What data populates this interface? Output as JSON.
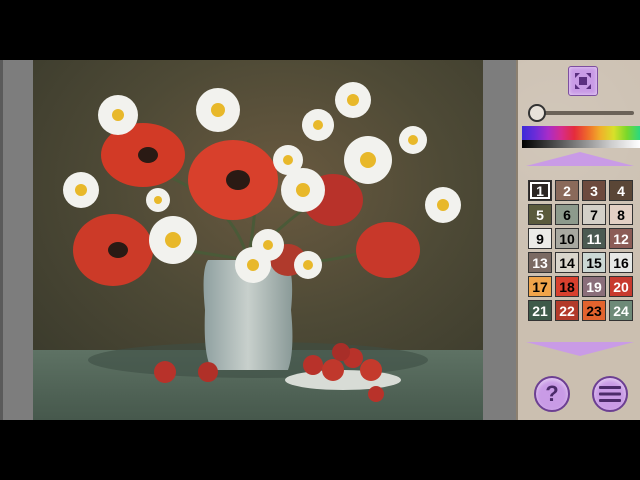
{
  "palette": {
    "selected_index": 0,
    "swatches": [
      {
        "number": "1",
        "color": "#2c2623",
        "text_color": "#ffffff"
      },
      {
        "number": "2",
        "color": "#8a6a5a",
        "text_color": "#ffffff"
      },
      {
        "number": "3",
        "color": "#6d4a3e",
        "text_color": "#ffffff"
      },
      {
        "number": "4",
        "color": "#5a4636",
        "text_color": "#ffffff"
      },
      {
        "number": "5",
        "color": "#5a5a3c",
        "text_color": "#ffffff"
      },
      {
        "number": "6",
        "color": "#8d9a8c",
        "text_color": "#000000"
      },
      {
        "number": "7",
        "color": "#d3d0c8",
        "text_color": "#000000"
      },
      {
        "number": "8",
        "color": "#e3d0c4",
        "text_color": "#000000"
      },
      {
        "number": "9",
        "color": "#ecebe7",
        "text_color": "#000000"
      },
      {
        "number": "10",
        "color": "#a8a8a0",
        "text_color": "#000000"
      },
      {
        "number": "11",
        "color": "#4a5a52",
        "text_color": "#ffffff"
      },
      {
        "number": "12",
        "color": "#8c5c56",
        "text_color": "#ffffff"
      },
      {
        "number": "13",
        "color": "#7a6a62",
        "text_color": "#ffffff"
      },
      {
        "number": "14",
        "color": "#dad6cc",
        "text_color": "#000000"
      },
      {
        "number": "15",
        "color": "#cbd8d4",
        "text_color": "#000000"
      },
      {
        "number": "16",
        "color": "#e6e8e6",
        "text_color": "#000000"
      },
      {
        "number": "17",
        "color": "#f0a44a",
        "text_color": "#000000"
      },
      {
        "number": "18",
        "color": "#d8402e",
        "text_color": "#000000"
      },
      {
        "number": "19",
        "color": "#8a6e7a",
        "text_color": "#ffffff"
      },
      {
        "number": "20",
        "color": "#c83a2e",
        "text_color": "#ffffff"
      },
      {
        "number": "21",
        "color": "#3e5a4a",
        "text_color": "#ffffff"
      },
      {
        "number": "22",
        "color": "#b23a2a",
        "text_color": "#ffffff"
      },
      {
        "number": "23",
        "color": "#e2632e",
        "text_color": "#000000"
      },
      {
        "number": "24",
        "color": "#6e8a78",
        "text_color": "#ffffff"
      }
    ]
  },
  "buttons": {
    "help_label": "?"
  },
  "icons": {
    "fit": "fit-to-screen-icon",
    "help": "question-icon",
    "menu": "hamburger-menu-icon"
  },
  "zoom": {
    "level": 0
  }
}
